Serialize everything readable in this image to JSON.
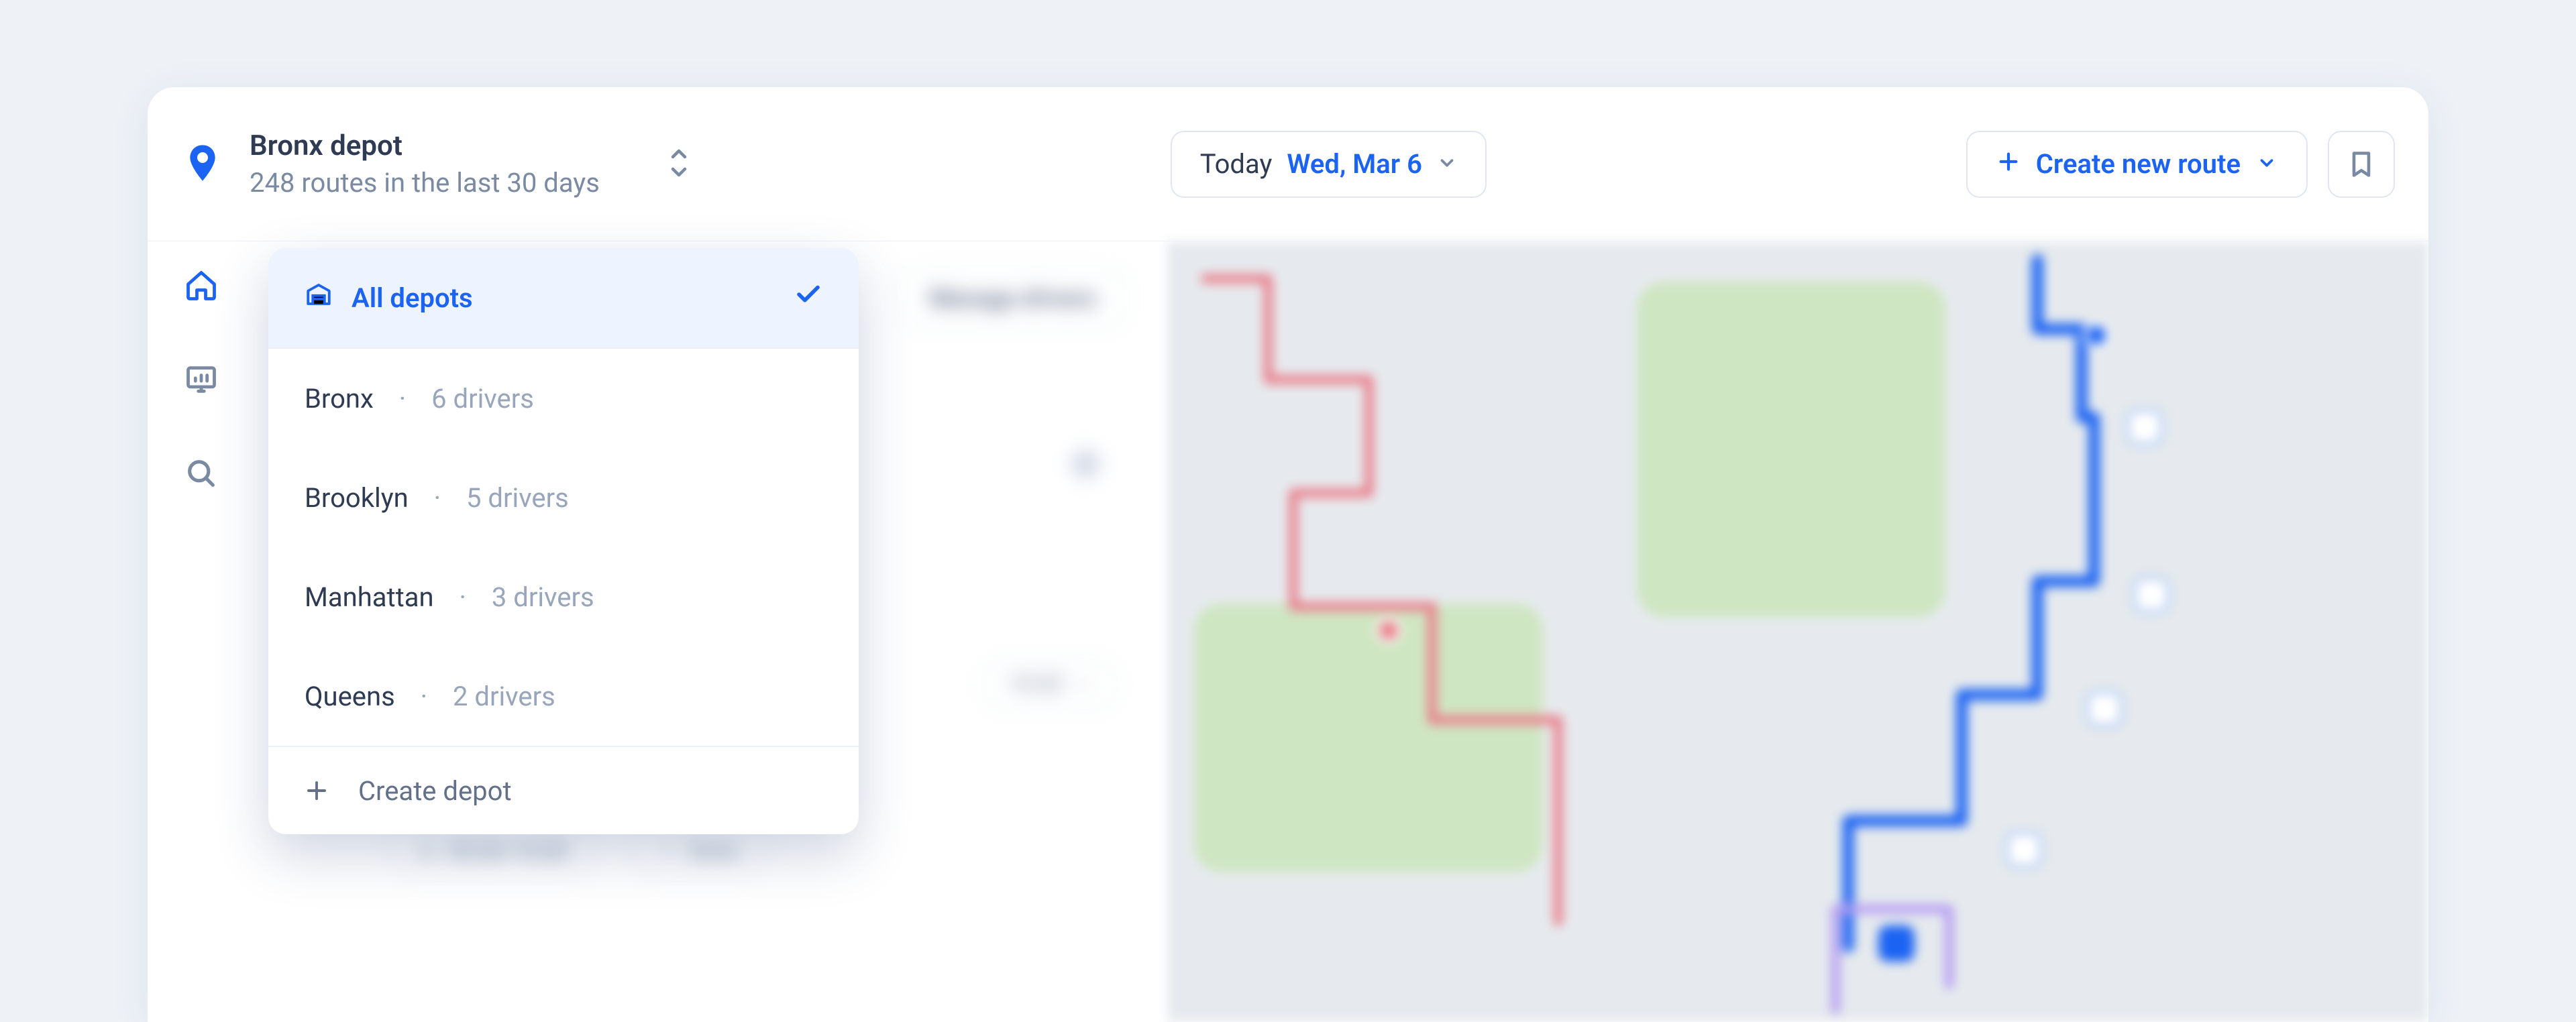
{
  "header": {
    "depot_name": "Bronx depot",
    "subtitle": "248 routes in the last 30 days",
    "today_label": "Today",
    "today_date": "Wed, Mar 6",
    "create_route": "Create new route"
  },
  "dropdown": {
    "all_label": "All depots",
    "items": [
      {
        "name": "Bronx",
        "meta": "6 drivers"
      },
      {
        "name": "Brooklyn",
        "meta": "5 drivers"
      },
      {
        "name": "Manhattan",
        "meta": "3 drivers"
      },
      {
        "name": "Queens",
        "meta": "2 drivers"
      }
    ],
    "create_label": "Create depot"
  },
  "panel": {
    "manage_drivers": "Manage drivers",
    "time_pill_1": "10:02",
    "time_pill_2": "09:00-10:00",
    "time_pill_3": "5min"
  }
}
